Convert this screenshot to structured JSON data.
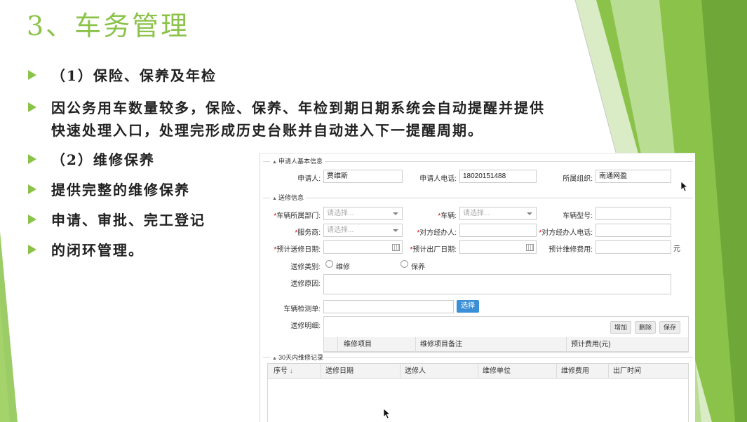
{
  "slide": {
    "title": "3、车务管理",
    "bullets": [
      "（1）保险、保养及年检",
      "因公务用车数量较多，保险、保养、年检到期日期系统会自动提醒并提供",
      "快速处理入口，处理完形成历史台账并自动进入下一提醒周期。",
      "（2）维修保养",
      "提供完整的维修保养",
      "申请、审批、完工登记",
      "的闭环管理。"
    ],
    "accent_color": "#8bc34a"
  },
  "form": {
    "section_applicant": "申请人基本信息",
    "applicant_label": "申请人:",
    "applicant_value": "贾维斯",
    "phone_label": "申请人电话:",
    "phone_value": "18020151488",
    "org_label": "所属组织:",
    "org_value": "南通网盈",
    "section_repair": "送修信息",
    "dept_label": "车辆所属部门:",
    "dept_placeholder": "请选择...",
    "vehicle_label": "车辆:",
    "vehicle_placeholder": "请选择...",
    "model_label": "车辆型号:",
    "provider_label": "服务商:",
    "provider_placeholder": "请选择...",
    "contact_label": "对方经办人:",
    "contact_phone_label": "对方经办人电话:",
    "send_date_label": "预计送修日期:",
    "out_date_label": "预计出厂日期:",
    "cost_label": "预计维修费用:",
    "cost_unit": "元",
    "type_label": "送修类别:",
    "type_option_repair": "维修",
    "type_option_maintain": "保养",
    "reason_label": "送修原因:",
    "inspection_label": "车辆检测单:",
    "select_button": "选择",
    "details_label": "送修明细:",
    "add_button": "增加",
    "delete_button": "删除",
    "save_button": "保存",
    "detail_columns": [
      "维修项目",
      "维修项目备注",
      "预计费用(元)"
    ],
    "section_history": "30天内维修记录",
    "history_columns": [
      "序号",
      "送修日期",
      "送修人",
      "维修单位",
      "维修费用",
      "出厂时间"
    ]
  }
}
